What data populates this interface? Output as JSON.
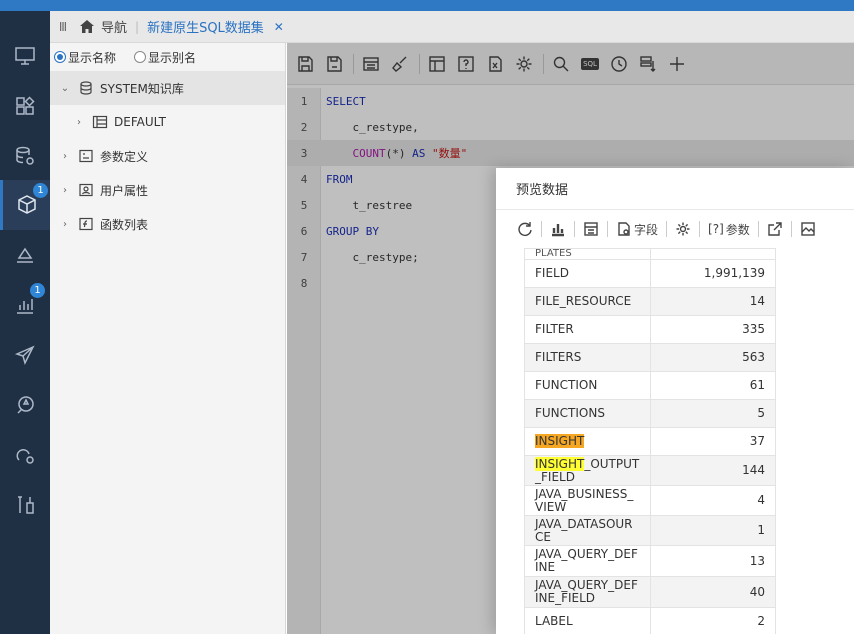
{
  "tabs": {
    "home_label": "导航",
    "active_label": "新建原生SQL数据集",
    "close": "✕"
  },
  "nav_badges": {
    "models": "1",
    "analysis": "1"
  },
  "tree": {
    "radio_show_name": "显示名称",
    "radio_show_alias": "显示别名",
    "items": [
      {
        "label": "SYSTEM知识库",
        "arrow": "⌄"
      },
      {
        "label": "DEFAULT",
        "arrow": "›"
      },
      {
        "label": "参数定义",
        "arrow": "›"
      },
      {
        "label": "用户属性",
        "arrow": "›"
      },
      {
        "label": "函数列表",
        "arrow": "›"
      }
    ]
  },
  "toolbar": {
    "sql_chip": "SQL"
  },
  "code": {
    "line_numbers": [
      "1",
      "2",
      "3",
      "4",
      "5",
      "6",
      "7",
      "8"
    ],
    "l1": "SELECT",
    "l2": "    c_restype,",
    "l3_fn": "COUNT",
    "l3_args": "(*)",
    "l3_as": "AS",
    "l3_str": "\"数量\"",
    "l4": "FROM",
    "l5": "    t_restree",
    "l6": "GROUP BY",
    "l7": "    c_restype;"
  },
  "dialog": {
    "title": "预览数据",
    "tools": {
      "field_label": "字段",
      "param_label": "参数",
      "param_prefix": "[?]"
    },
    "clipped_top": "PLATES",
    "rows": [
      {
        "name": "FIELD",
        "value": "1,991,139"
      },
      {
        "name": "FILE_RESOURCE",
        "value": "14"
      },
      {
        "name": "FILTER",
        "value": "335"
      },
      {
        "name": "FILTERS",
        "value": "563"
      },
      {
        "name": "FUNCTION",
        "value": "61"
      },
      {
        "name": "FUNCTIONS",
        "value": "5"
      },
      {
        "name": "INSIGHT",
        "value": "37"
      },
      {
        "name_highlight": "INSIGHT",
        "name_rest": "_OUTPUT_FIELD",
        "value": "144"
      },
      {
        "name": "JAVA_BUSINESS_VIEW",
        "value": "4"
      },
      {
        "name": "JAVA_DATASOURCE",
        "value": "1"
      },
      {
        "name": "JAVA_QUERY_DEFINE",
        "value": "13"
      },
      {
        "name": "JAVA_QUERY_DEFINE_FIELD",
        "value": "40"
      },
      {
        "name": "LABEL",
        "value": "2"
      }
    ]
  }
}
